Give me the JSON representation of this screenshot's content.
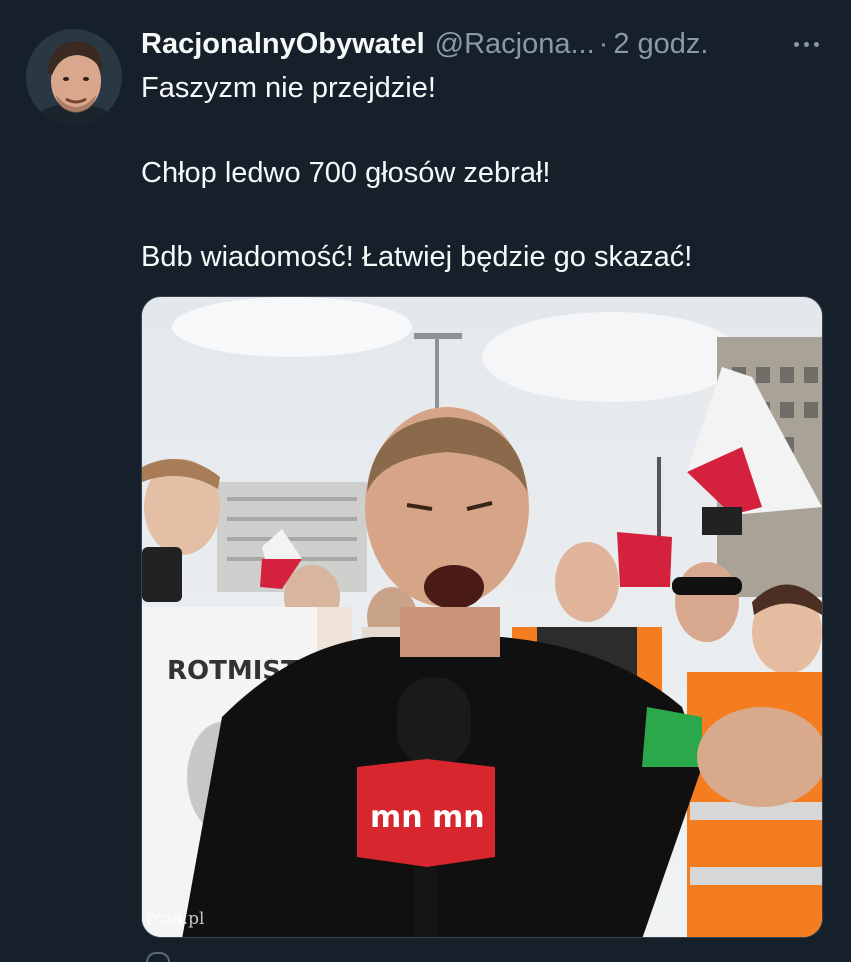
{
  "tweet": {
    "author": {
      "display_name": "RacjonalnyObywatel",
      "handle": "@Racjona...",
      "separator": "·",
      "time": "2 godz."
    },
    "text_lines": [
      "Faszyzm nie przejdzie!",
      "Chłop ledwo 700 głosów zebrał!",
      "Bdb wiadomość! Łatwiej będzie go skazać!"
    ],
    "media": {
      "shirt_text": "ROTMISTRZ",
      "mic_logo": "mn",
      "watermark": "rcza.pl"
    },
    "more_icon": "more-horizontal-icon"
  },
  "colors": {
    "background": "#15202b",
    "primary_text": "#f7f9f9",
    "secondary_text": "#8b98a5",
    "flag_red": "#d4213d",
    "vest_orange": "#f57c1f",
    "mic_red": "#d7262e"
  }
}
